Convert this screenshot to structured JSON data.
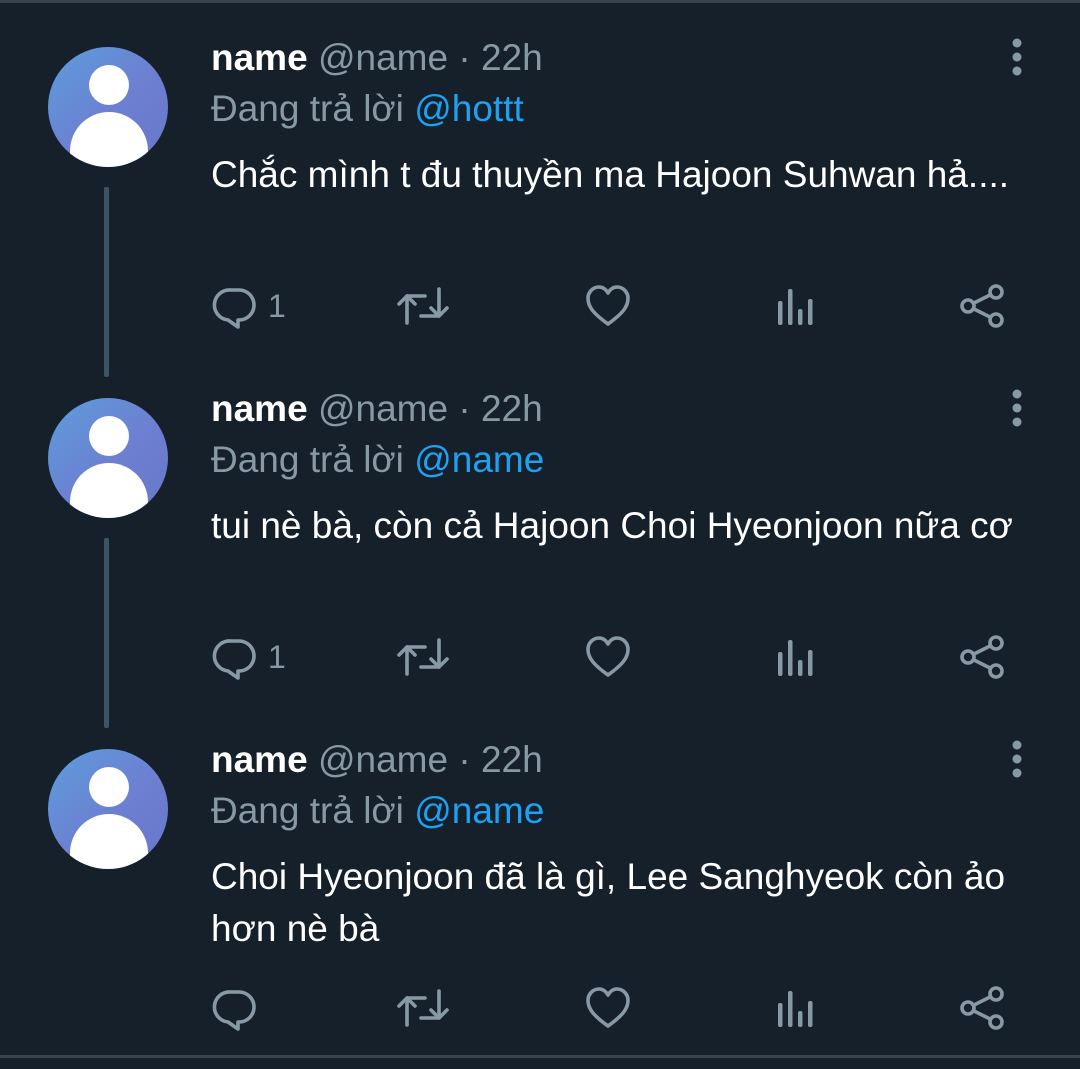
{
  "tweets": [
    {
      "display_name": "name",
      "handle": "@name",
      "separator": "·",
      "time": "22h",
      "reply_prefix": "Đang trả lời",
      "reply_to": "@hottt",
      "text": "Chắc mình t đu thuyền ma Hajoon Suhwan hả....",
      "reply_count": "1",
      "has_thread_line": true
    },
    {
      "display_name": "name",
      "handle": "@name",
      "separator": "·",
      "time": "22h",
      "reply_prefix": "Đang trả lời",
      "reply_to": "@name",
      "text": "tui nè bà, còn cả Hajoon Choi Hyeonjoon nữa cơ",
      "reply_count": "1",
      "has_thread_line": true
    },
    {
      "display_name": "name",
      "handle": "@name",
      "separator": "·",
      "time": "22h",
      "reply_prefix": "Đang trả lời",
      "reply_to": "@name",
      "text": "Choi Hyeonjoon đã là gì, Lee Sanghyeok còn ảo hơn nè bà",
      "reply_count": "",
      "has_thread_line": false
    }
  ],
  "icons": {
    "reply": "reply-icon",
    "retweet": "retweet-icon",
    "like": "heart-icon",
    "views": "analytics-icon",
    "share": "share-icon",
    "more": "more-vertical-icon"
  },
  "colors": {
    "background": "#15202b",
    "secondary_text": "#8899a6",
    "mention": "#1da1f2",
    "thread_line": "#3d5466",
    "icon": "#8899a6"
  }
}
